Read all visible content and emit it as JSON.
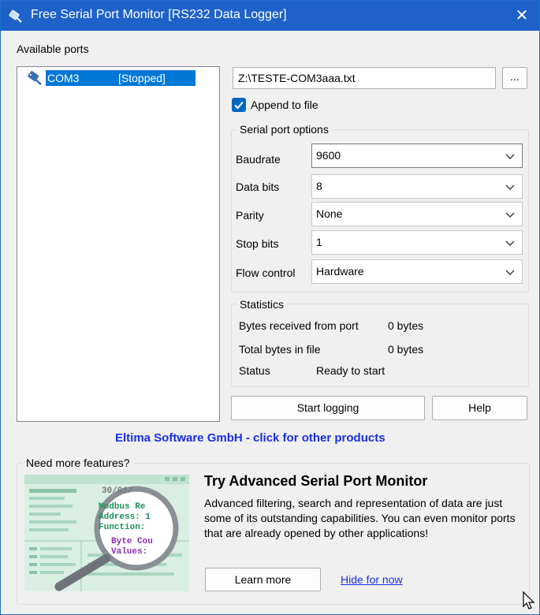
{
  "window": {
    "title": "Free Serial Port Monitor [RS232 Data Logger]",
    "close": "✕"
  },
  "ports": {
    "title": "Available ports",
    "items": [
      {
        "name": "COM3",
        "status": "[Stopped]"
      }
    ]
  },
  "file": {
    "path": "Z:\\TESTE-COM3aaa.txt",
    "browse": "...",
    "append_label": "Append to file",
    "append_checked": true
  },
  "serial_options": {
    "title": "Serial port options",
    "baudrate": {
      "label": "Baudrate",
      "value": "9600"
    },
    "data_bits": {
      "label": "Data bits",
      "value": "8"
    },
    "parity": {
      "label": "Parity",
      "value": "None"
    },
    "stop_bits": {
      "label": "Stop bits",
      "value": "1"
    },
    "flow_control": {
      "label": "Flow control",
      "value": "Hardware"
    }
  },
  "statistics": {
    "title": "Statistics",
    "received_label": "Bytes received from port",
    "received_value": "0 bytes",
    "total_label": "Total bytes in file",
    "total_value": "0 bytes",
    "status_label": "Status",
    "status_value": "Ready to start"
  },
  "buttons": {
    "start": "Start logging",
    "help": "Help"
  },
  "company_link": "Eltima Software GmbH - click for other products",
  "promo": {
    "group_title": "Need more features?",
    "heading": "Try Advanced Serial Port Monitor",
    "body": "Advanced filtering, search and representation of data are just some of its outstanding capabilities. You can even monitor ports that are already opened by other applications!",
    "learn_more": "Learn more",
    "hide": "Hide for now",
    "image_lines": [
      "30/01/",
      "Modbus Re",
      "Address: 1",
      "Function: ",
      "Byte Cou",
      "Values:"
    ]
  },
  "colors": {
    "titlebar": "#1e62c9",
    "selection": "#0078d7",
    "link": "#1a2ee6",
    "accent_check": "#0067c0"
  }
}
